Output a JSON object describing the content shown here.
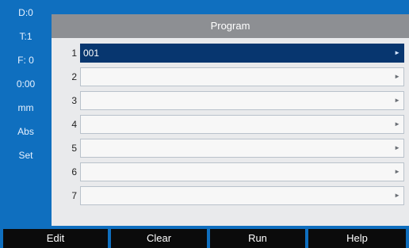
{
  "status": {
    "display": "D:0",
    "tool": "T:1",
    "feed": "F:  0",
    "time": "0:00",
    "units": "mm",
    "mode": "Abs",
    "datum": "Set"
  },
  "header": {
    "title": "Program"
  },
  "rows": [
    {
      "number": "1",
      "value": "001",
      "selected": true
    },
    {
      "number": "2",
      "value": ""
    },
    {
      "number": "3",
      "value": ""
    },
    {
      "number": "4",
      "value": ""
    },
    {
      "number": "5",
      "value": ""
    },
    {
      "number": "6",
      "value": ""
    },
    {
      "number": "7",
      "value": ""
    }
  ],
  "softkeys": {
    "edit": "Edit",
    "clear": "Clear",
    "run": "Run",
    "help": "Help"
  },
  "icons": {
    "row_arrow": "triangle-right-icon"
  },
  "colors": {
    "background": "#0f6fbf",
    "selected_row": "#07366f",
    "header": "#8d8f93"
  }
}
